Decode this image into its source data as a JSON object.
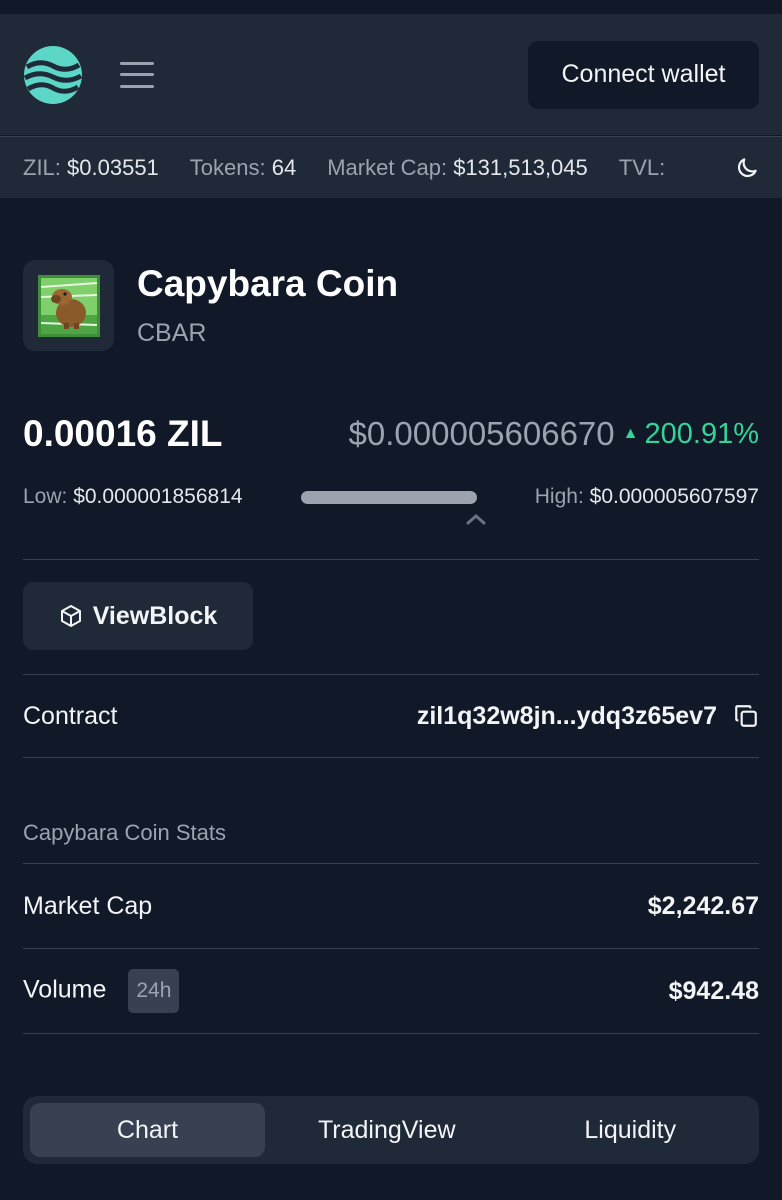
{
  "header": {
    "connect_label": "Connect wallet"
  },
  "stats_bar": {
    "zil_label": "ZIL:",
    "zil_value": "$0.03551",
    "tokens_label": "Tokens:",
    "tokens_value": "64",
    "mcap_label": "Market Cap:",
    "mcap_value": "$131,513,045",
    "tvl_label": "TVL:"
  },
  "token": {
    "name": "Capybara Coin",
    "symbol": "CBAR",
    "price_zil": "0.00016 ZIL",
    "price_usd": "$0.000005606670",
    "change_pct": "200.91%",
    "low_label": "Low:",
    "low_value": "$0.000001856814",
    "high_label": "High:",
    "high_value": "$0.000005607597",
    "viewblock_label": "ViewBlock",
    "contract_label": "Contract",
    "contract_value": "zil1q32w8jn...ydq3z65ev7"
  },
  "stats": {
    "title": "Capybara Coin Stats",
    "market_cap_label": "Market Cap",
    "market_cap_value": "$2,242.67",
    "volume_label": "Volume",
    "volume_badge": "24h",
    "volume_value": "$942.48"
  },
  "tabs": {
    "chart": "Chart",
    "tradingview": "TradingView",
    "liquidity": "Liquidity"
  },
  "colors": {
    "background": "#111827",
    "panel": "#1f2937",
    "accent": "#5cd6c6",
    "positive": "#34d399"
  },
  "icons": {
    "logo": "zilstream-logo",
    "menu": "hamburger-menu-icon",
    "theme": "moon-icon",
    "viewblock": "cube-icon",
    "copy": "copy-icon",
    "caret": "chevron-up-icon"
  }
}
